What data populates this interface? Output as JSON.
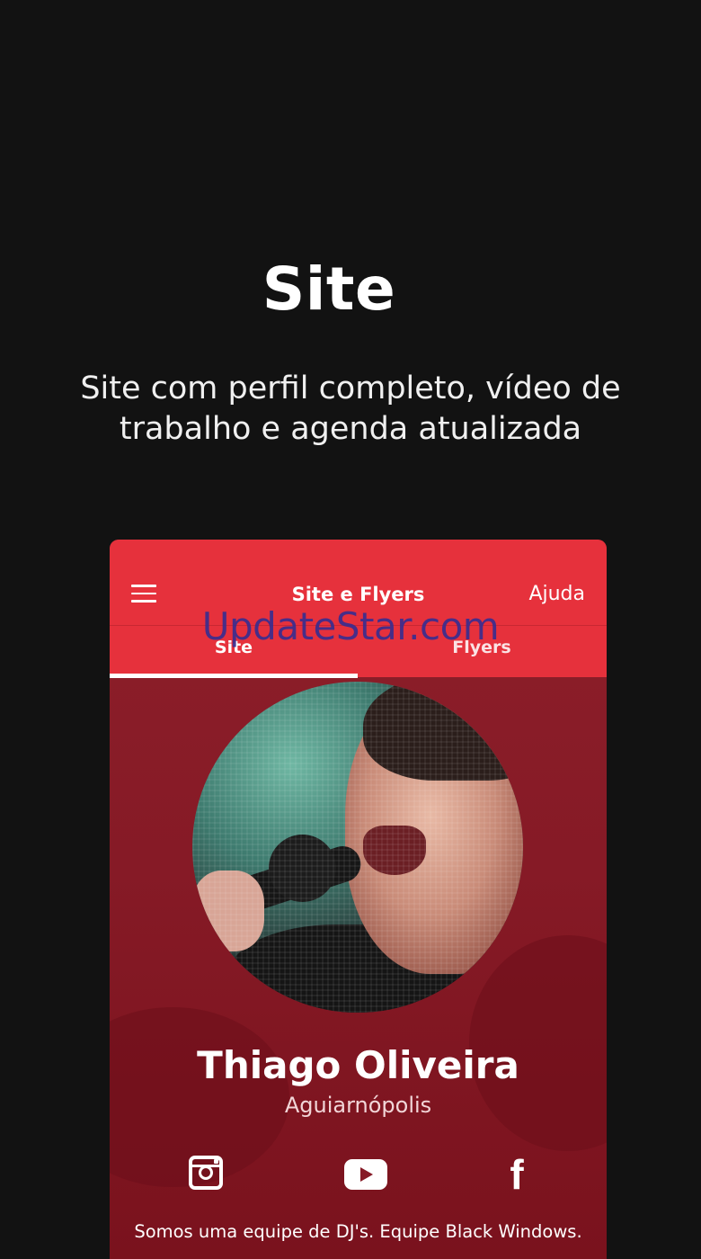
{
  "promo": {
    "title": "Site",
    "subtitle_line1": "Site com perfil completo, vídeo de",
    "subtitle_line2": "trabalho e agenda atualizada"
  },
  "app": {
    "appbar_title": "Site e Flyers",
    "help_label": "Ajuda",
    "tabs": [
      {
        "label": "Site",
        "active": true
      },
      {
        "label": "Flyers",
        "active": false
      }
    ],
    "accent_color": "#e6313c",
    "background_color": "#861a26"
  },
  "watermark": "UpdateStar.com",
  "profile": {
    "name": "Thiago Oliveira",
    "city": "Aguiarnópolis",
    "social_icons": [
      "instagram-icon",
      "youtube-icon",
      "facebook-icon"
    ],
    "description": "Somos uma equipe de DJ's. Equipe Black Windows."
  }
}
